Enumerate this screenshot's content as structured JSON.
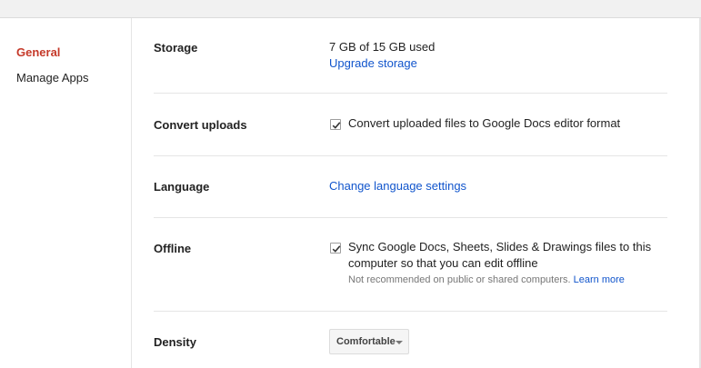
{
  "sidebar": {
    "items": [
      {
        "label": "General",
        "active": true
      },
      {
        "label": "Manage Apps",
        "active": false
      }
    ]
  },
  "settings": {
    "storage": {
      "label": "Storage",
      "usage": "7 GB of 15 GB used",
      "upgrade_link": "Upgrade storage"
    },
    "convert": {
      "label": "Convert uploads",
      "checked": true,
      "text": "Convert uploaded files to Google Docs editor format"
    },
    "language": {
      "label": "Language",
      "link": "Change language settings"
    },
    "offline": {
      "label": "Offline",
      "checked": true,
      "line1": "Sync Google Docs, Sheets, Slides & Drawings files to this",
      "line2": "computer so that you can edit offline",
      "hint": "Not recommended on public or shared computers.",
      "hint_link": "Learn more"
    },
    "density": {
      "label": "Density",
      "selected": "Comfortable"
    }
  },
  "colors": {
    "accent_active": "#c53929",
    "link": "#1155cc"
  }
}
